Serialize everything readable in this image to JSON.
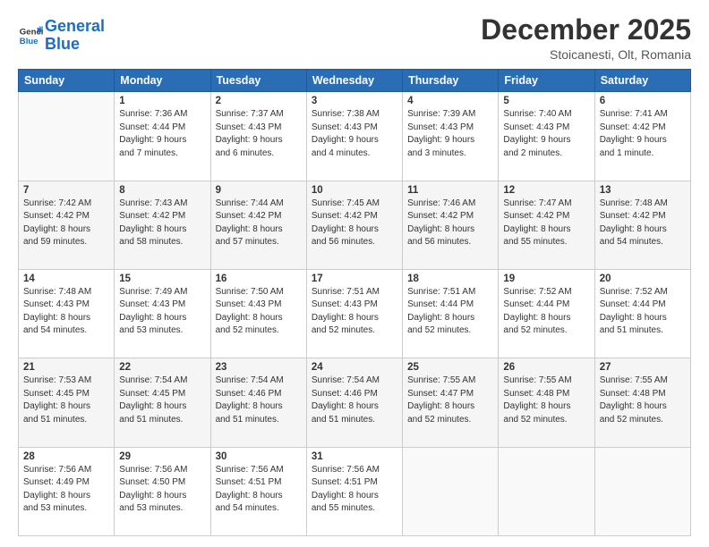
{
  "header": {
    "logo_line1": "General",
    "logo_line2": "Blue",
    "month": "December 2025",
    "location": "Stoicanesti, Olt, Romania"
  },
  "weekdays": [
    "Sunday",
    "Monday",
    "Tuesday",
    "Wednesday",
    "Thursday",
    "Friday",
    "Saturday"
  ],
  "weeks": [
    [
      {
        "day": "",
        "info": ""
      },
      {
        "day": "1",
        "info": "Sunrise: 7:36 AM\nSunset: 4:44 PM\nDaylight: 9 hours\nand 7 minutes."
      },
      {
        "day": "2",
        "info": "Sunrise: 7:37 AM\nSunset: 4:43 PM\nDaylight: 9 hours\nand 6 minutes."
      },
      {
        "day": "3",
        "info": "Sunrise: 7:38 AM\nSunset: 4:43 PM\nDaylight: 9 hours\nand 4 minutes."
      },
      {
        "day": "4",
        "info": "Sunrise: 7:39 AM\nSunset: 4:43 PM\nDaylight: 9 hours\nand 3 minutes."
      },
      {
        "day": "5",
        "info": "Sunrise: 7:40 AM\nSunset: 4:43 PM\nDaylight: 9 hours\nand 2 minutes."
      },
      {
        "day": "6",
        "info": "Sunrise: 7:41 AM\nSunset: 4:42 PM\nDaylight: 9 hours\nand 1 minute."
      }
    ],
    [
      {
        "day": "7",
        "info": "Sunrise: 7:42 AM\nSunset: 4:42 PM\nDaylight: 8 hours\nand 59 minutes."
      },
      {
        "day": "8",
        "info": "Sunrise: 7:43 AM\nSunset: 4:42 PM\nDaylight: 8 hours\nand 58 minutes."
      },
      {
        "day": "9",
        "info": "Sunrise: 7:44 AM\nSunset: 4:42 PM\nDaylight: 8 hours\nand 57 minutes."
      },
      {
        "day": "10",
        "info": "Sunrise: 7:45 AM\nSunset: 4:42 PM\nDaylight: 8 hours\nand 56 minutes."
      },
      {
        "day": "11",
        "info": "Sunrise: 7:46 AM\nSunset: 4:42 PM\nDaylight: 8 hours\nand 56 minutes."
      },
      {
        "day": "12",
        "info": "Sunrise: 7:47 AM\nSunset: 4:42 PM\nDaylight: 8 hours\nand 55 minutes."
      },
      {
        "day": "13",
        "info": "Sunrise: 7:48 AM\nSunset: 4:42 PM\nDaylight: 8 hours\nand 54 minutes."
      }
    ],
    [
      {
        "day": "14",
        "info": "Sunrise: 7:48 AM\nSunset: 4:43 PM\nDaylight: 8 hours\nand 54 minutes."
      },
      {
        "day": "15",
        "info": "Sunrise: 7:49 AM\nSunset: 4:43 PM\nDaylight: 8 hours\nand 53 minutes."
      },
      {
        "day": "16",
        "info": "Sunrise: 7:50 AM\nSunset: 4:43 PM\nDaylight: 8 hours\nand 52 minutes."
      },
      {
        "day": "17",
        "info": "Sunrise: 7:51 AM\nSunset: 4:43 PM\nDaylight: 8 hours\nand 52 minutes."
      },
      {
        "day": "18",
        "info": "Sunrise: 7:51 AM\nSunset: 4:44 PM\nDaylight: 8 hours\nand 52 minutes."
      },
      {
        "day": "19",
        "info": "Sunrise: 7:52 AM\nSunset: 4:44 PM\nDaylight: 8 hours\nand 52 minutes."
      },
      {
        "day": "20",
        "info": "Sunrise: 7:52 AM\nSunset: 4:44 PM\nDaylight: 8 hours\nand 51 minutes."
      }
    ],
    [
      {
        "day": "21",
        "info": "Sunrise: 7:53 AM\nSunset: 4:45 PM\nDaylight: 8 hours\nand 51 minutes."
      },
      {
        "day": "22",
        "info": "Sunrise: 7:54 AM\nSunset: 4:45 PM\nDaylight: 8 hours\nand 51 minutes."
      },
      {
        "day": "23",
        "info": "Sunrise: 7:54 AM\nSunset: 4:46 PM\nDaylight: 8 hours\nand 51 minutes."
      },
      {
        "day": "24",
        "info": "Sunrise: 7:54 AM\nSunset: 4:46 PM\nDaylight: 8 hours\nand 51 minutes."
      },
      {
        "day": "25",
        "info": "Sunrise: 7:55 AM\nSunset: 4:47 PM\nDaylight: 8 hours\nand 52 minutes."
      },
      {
        "day": "26",
        "info": "Sunrise: 7:55 AM\nSunset: 4:48 PM\nDaylight: 8 hours\nand 52 minutes."
      },
      {
        "day": "27",
        "info": "Sunrise: 7:55 AM\nSunset: 4:48 PM\nDaylight: 8 hours\nand 52 minutes."
      }
    ],
    [
      {
        "day": "28",
        "info": "Sunrise: 7:56 AM\nSunset: 4:49 PM\nDaylight: 8 hours\nand 53 minutes."
      },
      {
        "day": "29",
        "info": "Sunrise: 7:56 AM\nSunset: 4:50 PM\nDaylight: 8 hours\nand 53 minutes."
      },
      {
        "day": "30",
        "info": "Sunrise: 7:56 AM\nSunset: 4:51 PM\nDaylight: 8 hours\nand 54 minutes."
      },
      {
        "day": "31",
        "info": "Sunrise: 7:56 AM\nSunset: 4:51 PM\nDaylight: 8 hours\nand 55 minutes."
      },
      {
        "day": "",
        "info": ""
      },
      {
        "day": "",
        "info": ""
      },
      {
        "day": "",
        "info": ""
      }
    ]
  ]
}
